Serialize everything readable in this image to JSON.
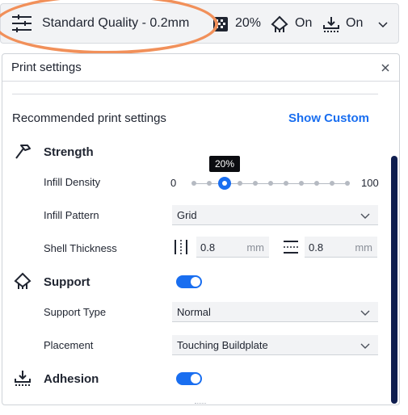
{
  "top_bar": {
    "profile_label": "Standard Quality - 0.2mm",
    "infill_value": "20%",
    "support_value": "On",
    "adhesion_value": "On"
  },
  "panel": {
    "title": "Print settings",
    "recommended_label": "Recommended print settings",
    "show_custom_label": "Show Custom",
    "strength": {
      "title": "Strength",
      "infill_density_label": "Infill Density",
      "infill_min": "0",
      "infill_max": "100",
      "infill_value": 20,
      "infill_tooltip": "20%",
      "infill_pattern_label": "Infill Pattern",
      "infill_pattern_value": "Grid",
      "shell_thickness_label": "Shell Thickness",
      "wall_value": "0.8",
      "wall_unit": "mm",
      "topbottom_value": "0.8",
      "topbottom_unit": "mm"
    },
    "support": {
      "title": "Support",
      "enabled": true,
      "support_type_label": "Support Type",
      "support_type_value": "Normal",
      "placement_label": "Placement",
      "placement_value": "Touching Buildplate"
    },
    "adhesion": {
      "title": "Adhesion",
      "enabled": true
    }
  },
  "colors": {
    "accent": "#196ef0",
    "highlight": "#f1905a",
    "scrollbar": "#0f1e4f"
  }
}
